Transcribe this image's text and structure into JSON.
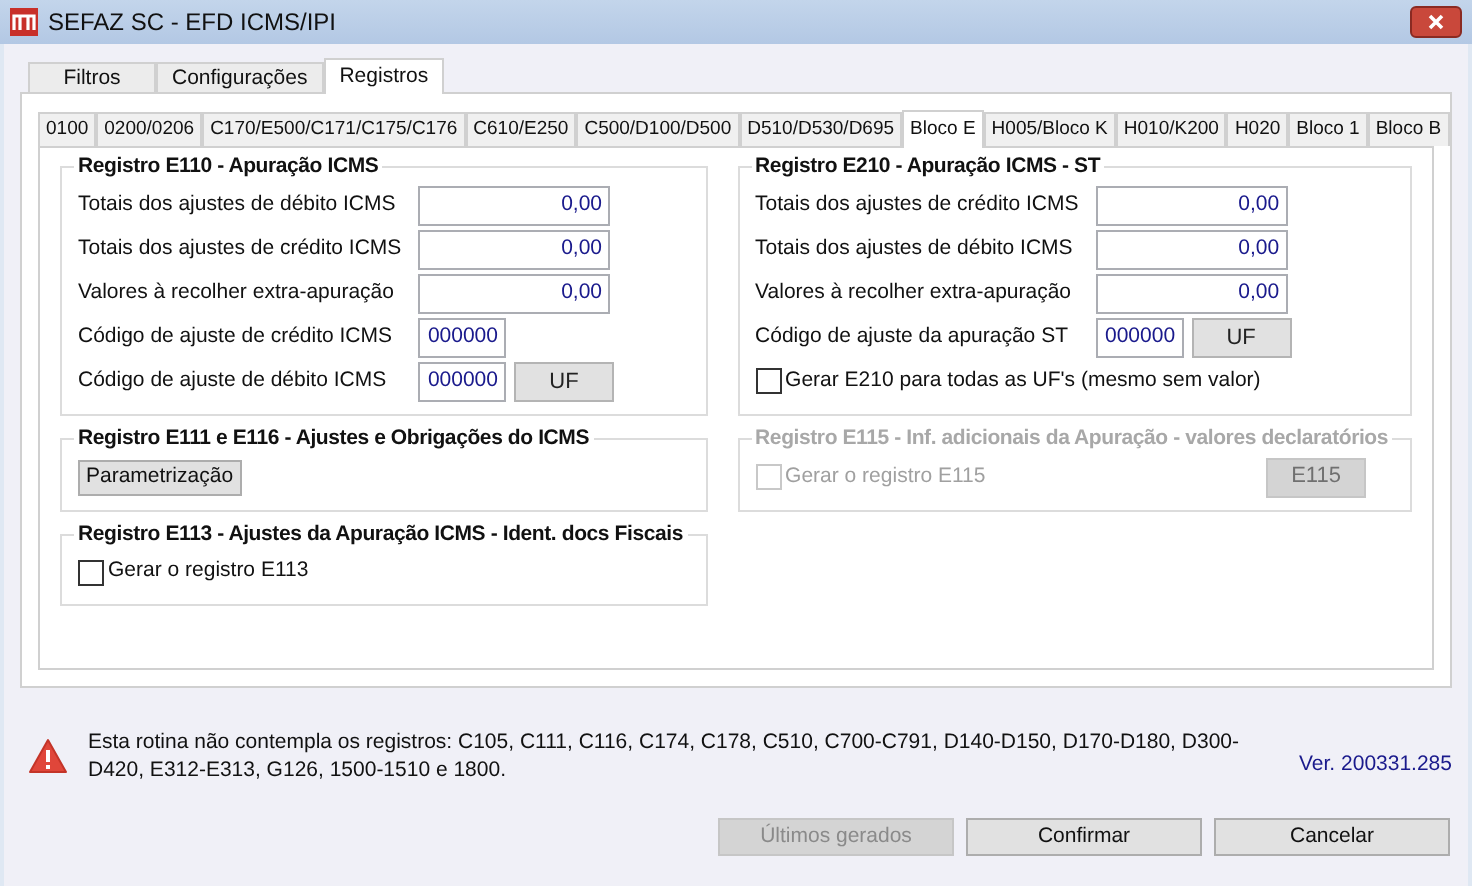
{
  "window": {
    "title": "SEFAZ SC - EFD ICMS/IPI"
  },
  "outer_tabs": [
    {
      "label": "Filtros",
      "selected": false
    },
    {
      "label": "Configurações",
      "selected": false
    },
    {
      "label": "Registros",
      "selected": true
    }
  ],
  "block_tabs": [
    {
      "label": "0100",
      "selected": false
    },
    {
      "label": "0200/0206",
      "selected": false
    },
    {
      "label": "C170/E500/C171/C175/C176",
      "selected": false
    },
    {
      "label": "C610/E250",
      "selected": false
    },
    {
      "label": "C500/D100/D500",
      "selected": false
    },
    {
      "label": "D510/D530/D695",
      "selected": false
    },
    {
      "label": "Bloco E",
      "selected": true
    },
    {
      "label": "H005/Bloco K",
      "selected": false
    },
    {
      "label": "H010/K200",
      "selected": false
    },
    {
      "label": "H020",
      "selected": false
    },
    {
      "label": "Bloco 1",
      "selected": false
    },
    {
      "label": "Bloco B",
      "selected": false
    }
  ],
  "left_groups": [
    {
      "title": "Registro E110  - Apuração ICMS",
      "disabled": false,
      "rows": [
        {
          "kind": "amount",
          "label": "Totais dos ajustes de débito ICMS",
          "value": "0,00"
        },
        {
          "kind": "amount",
          "label": "Totais dos ajustes de crédito ICMS",
          "value": "0,00"
        },
        {
          "kind": "amount",
          "label": "Valores à recolher extra-apuração",
          "value": "0,00"
        },
        {
          "kind": "code",
          "label": "Código de ajuste de crédito ICMS",
          "value": "000000"
        },
        {
          "kind": "code",
          "label": "Código de ajuste de débito ICMS",
          "value": "000000",
          "button": "UF"
        }
      ]
    },
    {
      "title": "Registro E111 e E116 - Ajustes e Obrigações do ICMS",
      "disabled": false,
      "rows": [
        {
          "kind": "button",
          "label": "Parametrização"
        }
      ]
    },
    {
      "title": "Registro E113 - Ajustes da Apuração ICMS - Ident. docs Fiscais",
      "disabled": false,
      "rows": [
        {
          "kind": "checkbox",
          "label": "Gerar o registro E113",
          "checked": false
        }
      ]
    }
  ],
  "right_groups": [
    {
      "title": "Registro E210  - Apuração ICMS - ST",
      "disabled": false,
      "rows": [
        {
          "kind": "amount",
          "label": "Totais dos ajustes de crédito ICMS",
          "value": "0,00"
        },
        {
          "kind": "amount",
          "label": "Totais dos ajustes de débito ICMS",
          "value": "0,00"
        },
        {
          "kind": "amount",
          "label": "Valores à recolher extra-apuração",
          "value": "0,00"
        },
        {
          "kind": "code",
          "label": "Código de ajuste da apuração ST",
          "value": "000000",
          "button": "UF"
        },
        {
          "kind": "checkbox",
          "label": "Gerar E210 para todas as UF's (mesmo sem valor)",
          "checked": false
        }
      ]
    },
    {
      "title": "Registro E115 - Inf. adicionais da Apuração - valores declaratórios",
      "disabled": true,
      "rows": [
        {
          "kind": "checkbox",
          "label": "Gerar o registro E115",
          "checked": false,
          "button": "E115"
        }
      ]
    }
  ],
  "notice": {
    "text": "Esta rotina não contempla os registros: C105, C111, C116, C174, C178, C510, C700-C791, D140-D150, D170-D180, D300-D420, E312-E313, G126, 1500-1510 e 1800.",
    "version": "Ver. 200331.285"
  },
  "buttons": [
    {
      "label": "Últimos gerados",
      "disabled": true
    },
    {
      "label": "Confirmar",
      "disabled": false
    },
    {
      "label": "Cancelar",
      "disabled": false
    }
  ]
}
